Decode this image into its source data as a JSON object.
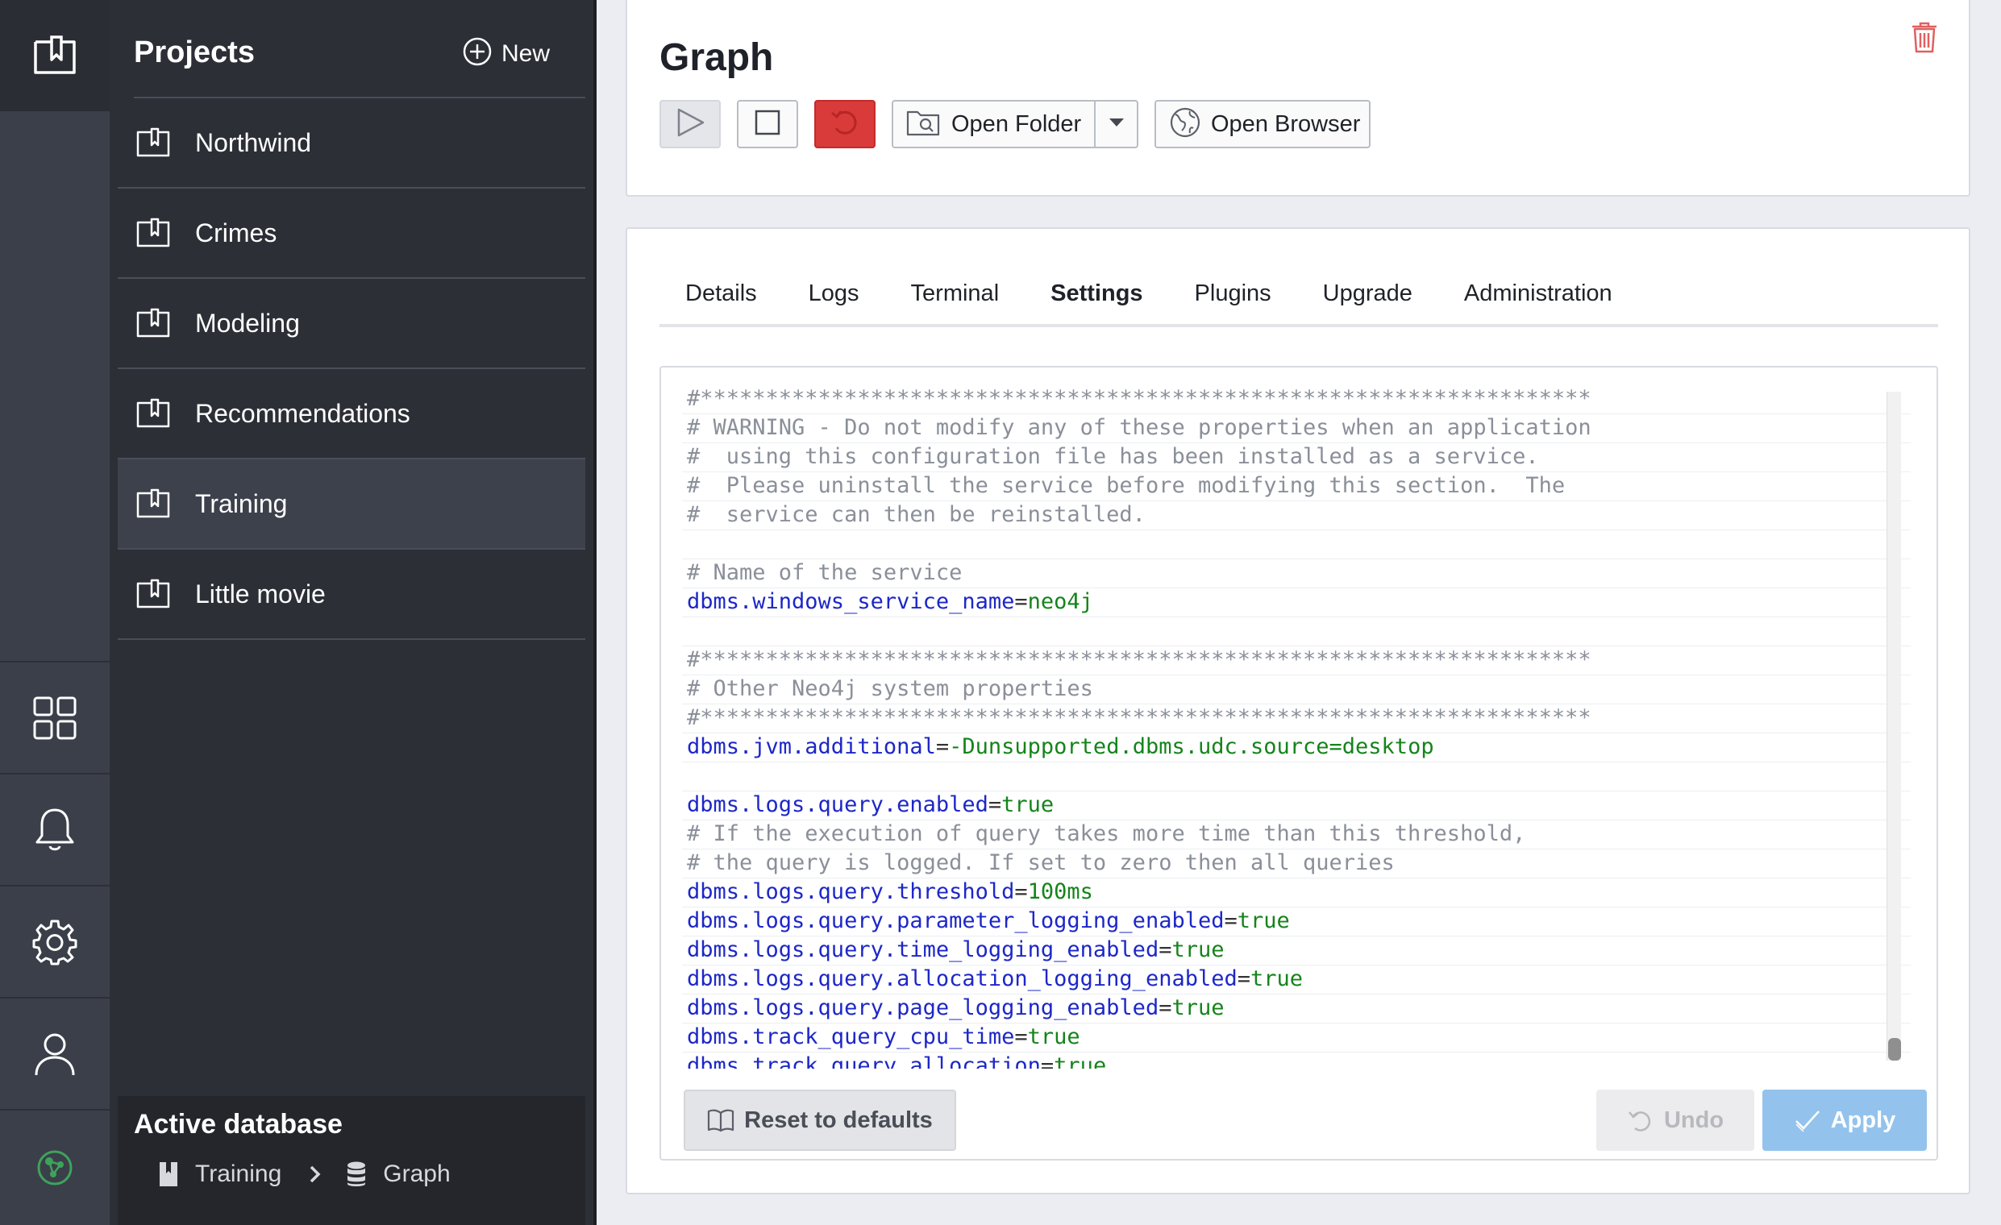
{
  "projects_panel": {
    "title": "Projects",
    "new_label": "New",
    "items": [
      {
        "label": "Northwind"
      },
      {
        "label": "Crimes"
      },
      {
        "label": "Modeling"
      },
      {
        "label": "Recommendations"
      },
      {
        "label": "Training",
        "active": true
      },
      {
        "label": "Little movie"
      }
    ]
  },
  "active_database": {
    "title": "Active database",
    "project": "Training",
    "database": "Graph"
  },
  "database": {
    "title": "Graph",
    "toolbar": {
      "open_folder_label": "Open Folder",
      "open_browser_label": "Open Browser"
    }
  },
  "tabs": [
    {
      "label": "Details"
    },
    {
      "label": "Logs"
    },
    {
      "label": "Terminal"
    },
    {
      "label": "Settings",
      "active": true
    },
    {
      "label": "Plugins"
    },
    {
      "label": "Upgrade"
    },
    {
      "label": "Administration"
    }
  ],
  "settings_lines": [
    {
      "type": "comment",
      "text": "#********************************************************************"
    },
    {
      "type": "comment",
      "text": "# WARNING - Do not modify any of these properties when an application"
    },
    {
      "type": "comment",
      "text": "#  using this configuration file has been installed as a service."
    },
    {
      "type": "comment",
      "text": "#  Please uninstall the service before modifying this section.  The"
    },
    {
      "type": "comment",
      "text": "#  service can then be reinstalled."
    },
    {
      "type": "blank",
      "text": ""
    },
    {
      "type": "comment",
      "text": "# Name of the service"
    },
    {
      "type": "setting",
      "key": "dbms.windows_service_name",
      "value": "neo4j"
    },
    {
      "type": "blank",
      "text": ""
    },
    {
      "type": "comment",
      "text": "#********************************************************************"
    },
    {
      "type": "comment",
      "text": "# Other Neo4j system properties"
    },
    {
      "type": "comment",
      "text": "#********************************************************************"
    },
    {
      "type": "setting",
      "key": "dbms.jvm.additional",
      "value": "-Dunsupported.dbms.udc.source=desktop"
    },
    {
      "type": "blank",
      "text": ""
    },
    {
      "type": "setting",
      "key": "dbms.logs.query.enabled",
      "value": "true"
    },
    {
      "type": "comment",
      "text": "# If the execution of query takes more time than this threshold,"
    },
    {
      "type": "comment",
      "text": "# the query is logged. If set to zero then all queries"
    },
    {
      "type": "setting",
      "key": "dbms.logs.query.threshold",
      "value": "100ms"
    },
    {
      "type": "setting",
      "key": "dbms.logs.query.parameter_logging_enabled",
      "value": "true"
    },
    {
      "type": "setting",
      "key": "dbms.logs.query.time_logging_enabled",
      "value": "true"
    },
    {
      "type": "setting",
      "key": "dbms.logs.query.allocation_logging_enabled",
      "value": "true"
    },
    {
      "type": "setting",
      "key": "dbms.logs.query.page_logging_enabled",
      "value": "true"
    },
    {
      "type": "setting",
      "key": "dbms.track_query_cpu_time",
      "value": "true"
    },
    {
      "type": "setting",
      "key": "dbms.track_query_allocation",
      "value": "true"
    }
  ],
  "editor_scroll_position": 1.0,
  "actions": {
    "reset_label": "Reset to defaults",
    "undo_label": "Undo",
    "apply_label": "Apply"
  },
  "icons": {
    "rail": [
      "projects-icon",
      "graph-apps-icon",
      "notifications-icon",
      "settings-icon",
      "user-icon",
      "neo4j-logo-icon"
    ],
    "project_item": "project-folder-icon",
    "delete": "trash-icon"
  },
  "colors": {
    "rail_bg": "#3b3f4a",
    "panel_bg": "#2c2f36",
    "danger": "#d93b3b",
    "apply": "#93c3ec",
    "setting_key": "#1d27c7",
    "setting_value": "#15841b",
    "comment": "#8a8f99"
  }
}
